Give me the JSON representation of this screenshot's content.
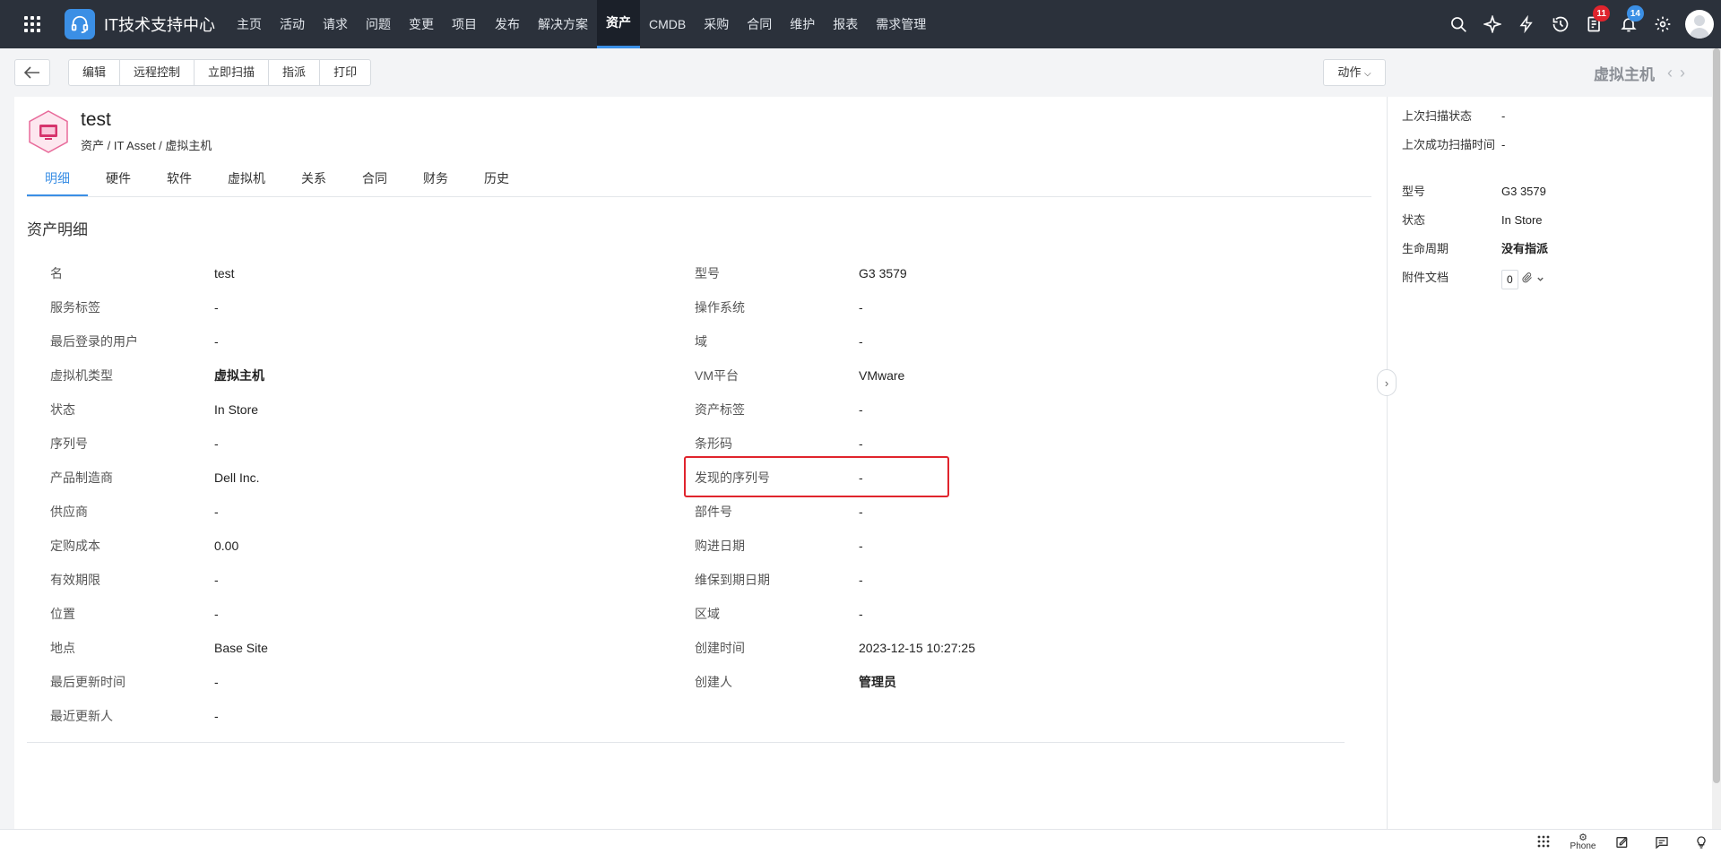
{
  "app": {
    "title": "IT技术支持中心"
  },
  "nav": {
    "items": [
      "主页",
      "活动",
      "请求",
      "问题",
      "变更",
      "项目",
      "发布",
      "解决方案",
      "资产",
      "CMDB",
      "采购",
      "合同",
      "维护",
      "报表",
      "需求管理"
    ],
    "active": "资产",
    "badges": {
      "tasks": "11",
      "notifications": "14"
    }
  },
  "toolbar": {
    "buttons": [
      "编辑",
      "远程控制",
      "立即扫描",
      "指派",
      "打印"
    ],
    "action_label": "动作"
  },
  "side_header": {
    "title": "虚拟主机"
  },
  "asset": {
    "name": "test",
    "breadcrumb": "资产  /  IT Asset /  虚拟主机"
  },
  "tabs": [
    "明细",
    "硬件",
    "软件",
    "虚拟机",
    "关系",
    "合同",
    "财务",
    "历史"
  ],
  "active_tab": "明细",
  "section_title": "资产明细",
  "details_left": [
    {
      "label": "名",
      "value": "test"
    },
    {
      "label": "服务标签",
      "value": "-"
    },
    {
      "label": "最后登录的用户",
      "value": "-"
    },
    {
      "label": "虚拟机类型",
      "value": "虚拟主机",
      "bold": true
    },
    {
      "label": "状态",
      "value": "In Store"
    },
    {
      "label": "序列号",
      "value": "-"
    },
    {
      "label": "产品制造商",
      "value": "Dell Inc."
    },
    {
      "label": "供应商",
      "value": "-"
    },
    {
      "label": "定购成本",
      "value": "0.00"
    },
    {
      "label": "有效期限",
      "value": "-"
    },
    {
      "label": "位置",
      "value": "-"
    },
    {
      "label": "地点",
      "value": "Base Site"
    },
    {
      "label": "最后更新时间",
      "value": "-"
    },
    {
      "label": "最近更新人",
      "value": "-"
    }
  ],
  "details_right": [
    {
      "label": "型号",
      "value": "G3 3579"
    },
    {
      "label": "操作系统",
      "value": "-"
    },
    {
      "label": "域",
      "value": "-"
    },
    {
      "label": "VM平台",
      "value": "VMware"
    },
    {
      "label": "资产标签",
      "value": "-"
    },
    {
      "label": "条形码",
      "value": "-"
    },
    {
      "label": "发现的序列号",
      "value": "-"
    },
    {
      "label": "部件号",
      "value": "-"
    },
    {
      "label": "购进日期",
      "value": "-"
    },
    {
      "label": "维保到期日期",
      "value": "-"
    },
    {
      "label": "区域",
      "value": "-"
    },
    {
      "label": "创建时间",
      "value": "2023-12-15 10:27:25"
    },
    {
      "label": "创建人",
      "value": "管理员",
      "bold": true
    }
  ],
  "side_panel": [
    {
      "label": "上次扫描状态",
      "value": "-"
    },
    {
      "label": "上次成功扫描时间",
      "value": "-"
    },
    {
      "label": "型号",
      "value": "G3 3579"
    },
    {
      "label": "状态",
      "value": "In Store"
    },
    {
      "label": "生命周期",
      "value": "没有指派",
      "bold": true
    },
    {
      "label": "附件文档",
      "value": "0"
    }
  ],
  "bottom": {
    "phone_label": "Phone"
  },
  "colors": {
    "accent": "#3b8fe5",
    "nav_bg": "#2b313b",
    "highlight": "#e0242d",
    "badge_red": "#e0242d"
  }
}
